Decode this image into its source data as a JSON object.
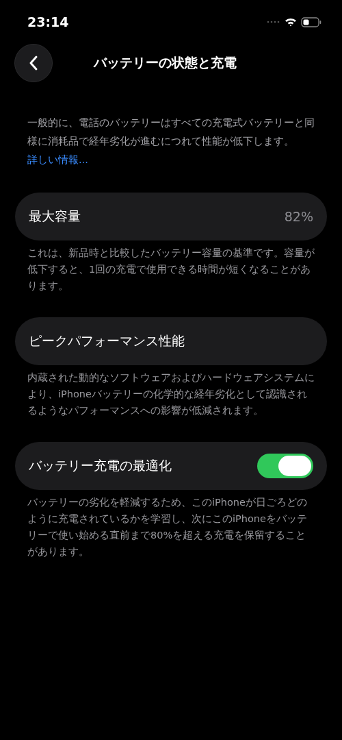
{
  "status_bar": {
    "time": "23:14"
  },
  "header": {
    "title": "バッテリーの状態と充電"
  },
  "intro": {
    "text": "一般的に、電話のバッテリーはすべての充電式バッテリーと同様に消耗品で経年劣化が進むにつれて性能が低下します。",
    "link": "詳しい情報..."
  },
  "sections": [
    {
      "kind": "value",
      "label": "最大容量",
      "value": "82%",
      "footer": "これは、新品時と比較したバッテリー容量の基準です。容量が低下すると、1回の充電で使用できる時間が短くなることがあります。"
    },
    {
      "kind": "plain",
      "label": "ピークパフォーマンス性能",
      "footer": "内蔵された動的なソフトウェアおよびハードウェアシステムにより、iPhoneバッテリーの化学的な経年劣化として認識されるようなパフォーマンスへの影響が低減されます。"
    },
    {
      "kind": "toggle",
      "label": "バッテリー充電の最適化",
      "on": true,
      "footer": "バッテリーの劣化を軽減するため、このiPhoneが日ごろどのように充電されているかを学習し、次にこのiPhoneをバッテリーで使い始める直前まで80%を超える充電を保留することがあります。"
    }
  ]
}
